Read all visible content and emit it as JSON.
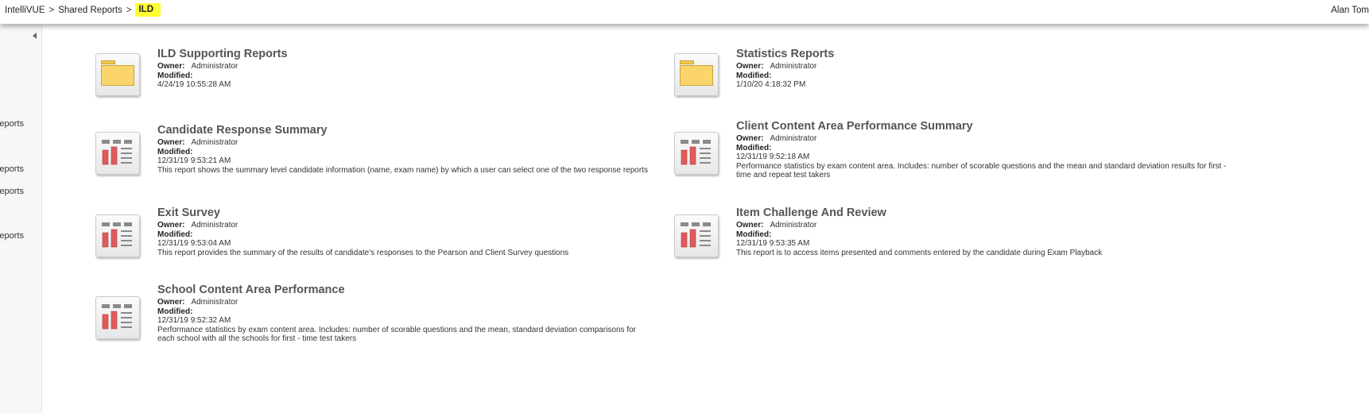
{
  "breadcrumb": {
    "items": [
      "IntelliVUE",
      "Shared Reports"
    ],
    "separator": ">",
    "current": "ILD"
  },
  "user": {
    "name": "Alan Tom"
  },
  "left_nav": {
    "items": [
      "Reports",
      "Supporting Reports",
      "Reports",
      "Reports"
    ]
  },
  "labels": {
    "owner": "Owner:",
    "modified": "Modified:"
  },
  "reports": [
    {
      "kind": "folder",
      "title": "ILD Supporting Reports",
      "owner": "Administrator",
      "modified": "4/24/19 10:55:28 AM",
      "description": ""
    },
    {
      "kind": "folder",
      "title": "Statistics Reports",
      "owner": "Administrator",
      "modified": "1/10/20 4:18:32 PM",
      "description": ""
    },
    {
      "kind": "report",
      "title": "Candidate Response Summary",
      "owner": "Administrator",
      "modified": "12/31/19 9:53:21 AM",
      "description": "This report shows the summary level candidate information (name, exam name) by which a user can select one of the two response reports"
    },
    {
      "kind": "report",
      "title": "Client Content Area Performance Summary",
      "owner": "Administrator",
      "modified": "12/31/19 9:52:18 AM",
      "description": "Performance statistics by exam content area.  Includes: number of scorable questions and the mean and standard deviation results for first - time and repeat test takers"
    },
    {
      "kind": "report",
      "title": "Exit Survey",
      "owner": "Administrator",
      "modified": "12/31/19 9:53:04 AM",
      "description": "This report provides the summary of the results of candidate's responses to the Pearson and Client Survey questions"
    },
    {
      "kind": "report",
      "title": "Item Challenge And Review",
      "owner": "Administrator",
      "modified": "12/31/19 9:53:35 AM",
      "description": "This report is to access items presented and comments entered by the candidate during Exam Playback"
    },
    {
      "kind": "report",
      "title": "School Content Area Performance",
      "owner": "Administrator",
      "modified": "12/31/19 9:52:32 AM",
      "description": "Performance statistics by exam content area.  Includes: number of scorable questions and the mean, standard deviation comparisons for each school with all the schools for first - time test takers"
    }
  ],
  "colors": {
    "highlight": "#ffff33",
    "folder": "#fbd56c",
    "report_bar": "#e05a5a",
    "title_text": "#555555"
  }
}
